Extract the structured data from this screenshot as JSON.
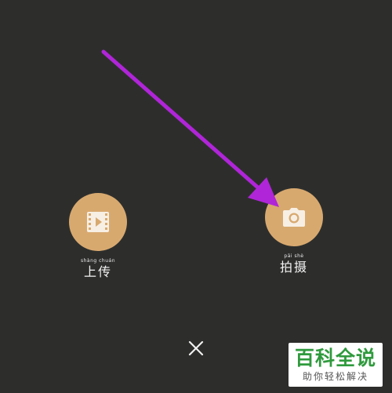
{
  "actions": {
    "upload": {
      "pinyin": "shàng chuán",
      "label": "上传",
      "icon": "video-file-icon"
    },
    "shoot": {
      "pinyin": "pāi shè",
      "label": "拍摄",
      "icon": "camera-icon"
    }
  },
  "close": {
    "icon": "close-icon"
  },
  "annotation": {
    "icon": "pointer-arrow-icon",
    "color": "#b025d8"
  },
  "watermark": {
    "title": "百科全说",
    "subtitle": "助你轻松解决"
  },
  "colors": {
    "background": "#2d2e2c",
    "button": "#d8a96f",
    "watermark_green": "#2f9a3d"
  }
}
